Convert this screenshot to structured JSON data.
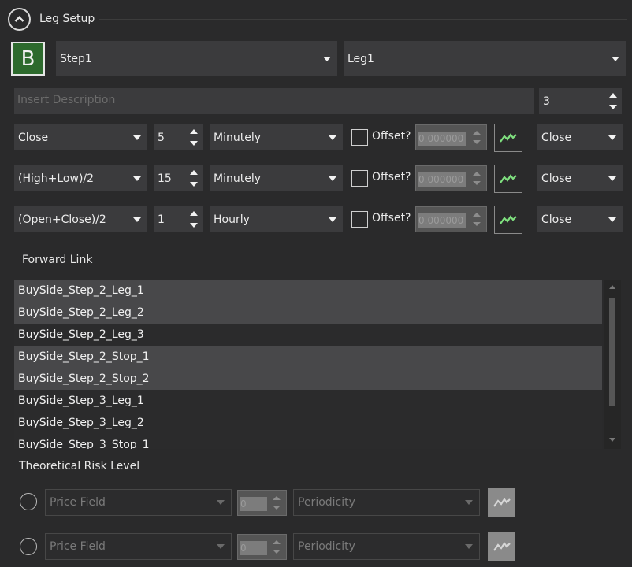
{
  "header": {
    "title": "Leg Setup",
    "collapse_icon": "chevron-up-icon"
  },
  "badge": {
    "letter": "B",
    "color": "#2d6a2d"
  },
  "step_select": {
    "value": "Step1"
  },
  "leg_select": {
    "value": "Leg1"
  },
  "description": {
    "placeholder": "Insert Description"
  },
  "count": {
    "value": "3"
  },
  "rows": [
    {
      "price_field": "Close",
      "period_count": "5",
      "periodicity": "Minutely",
      "offset_label": "Offset?",
      "offset_value": "0.000000",
      "output": "Close"
    },
    {
      "price_field": "(High+Low)/2",
      "period_count": "15",
      "periodicity": "Minutely",
      "offset_label": "Offset?",
      "offset_value": "0.000000",
      "output": "Close"
    },
    {
      "price_field": "(Open+Close)/2",
      "period_count": "1",
      "periodicity": "Hourly",
      "offset_label": "Offset?",
      "offset_value": "0.000000",
      "output": "Close"
    }
  ],
  "forward_link": {
    "label": "Forward Link",
    "items": [
      {
        "label": "BuySide_Step_2_Leg_1",
        "selected": true
      },
      {
        "label": "BuySide_Step_2_Leg_2",
        "selected": true
      },
      {
        "label": "BuySide_Step_2_Leg_3",
        "selected": false
      },
      {
        "label": "BuySide_Step_2_Stop_1",
        "selected": true
      },
      {
        "label": "BuySide_Step_2_Stop_2",
        "selected": true
      },
      {
        "label": "BuySide_Step_3_Leg_1",
        "selected": false
      },
      {
        "label": "BuySide_Step_3_Leg_2",
        "selected": false
      },
      {
        "label": "BuySide_Step_3_Stop_1",
        "selected": false
      }
    ]
  },
  "risk": {
    "label": "Theoretical Risk Level",
    "rows": [
      {
        "price_field_placeholder": "Price Field",
        "count_value": "0",
        "periodicity_placeholder": "Periodicity"
      },
      {
        "price_field_placeholder": "Price Field",
        "count_value": "0",
        "periodicity_placeholder": "Periodicity"
      }
    ]
  },
  "colors": {
    "background": "#2a2a2b",
    "control": "#3b3b3d",
    "chart_line": "#7fe07f"
  }
}
